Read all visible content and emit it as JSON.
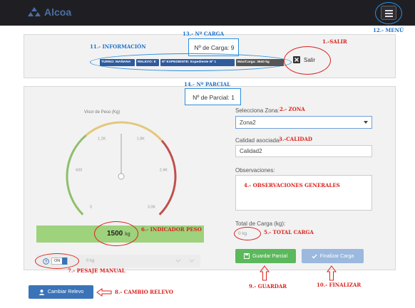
{
  "brand": {
    "name": "Alcoa",
    "color": "#4a6fa5"
  },
  "header": {
    "carga_label": "Nº de Carga: 9"
  },
  "badges": [
    {
      "text": "TURNO: MAÑANA",
      "color": "#2f5a9b"
    },
    {
      "text": "RELEVO: E",
      "color": "#2f5a9b"
    },
    {
      "text": "Nº EXPEDIENTE: Expediente Nº 1",
      "color": "#2f5a9b"
    },
    {
      "text": "Máx/Carga: 3640 kg",
      "color": "#555555"
    }
  ],
  "salir": {
    "label": "Salir",
    "icon": "close-icon"
  },
  "parcial": {
    "label": "Nº de Parcial: 1"
  },
  "gauge": {
    "title": "Visor de Peso (Kg)",
    "ticks": [
      "0",
      "600",
      "1.2K",
      "1.8K",
      "2.4K",
      "3.0K"
    ],
    "value_number": "1500",
    "value_unit": "kg",
    "value": 1500,
    "max": 3000,
    "colors": {
      "low": "#8fbf6d",
      "mid": "#e3c77a",
      "high": "#c0504d"
    },
    "bar_color": "#9ed27c"
  },
  "manual": {
    "toggle_label": "ON",
    "input_placeholder": "0 kg"
  },
  "form": {
    "zona_label": "Selecciona Zona:",
    "zona_value": "Zona2",
    "calidad_label": "Calidad asociada:",
    "calidad_value": "Calidad2",
    "obs_label": "Observaciones:",
    "total_label": "Total de Carga (kg):",
    "total_value": "0 kg"
  },
  "buttons": {
    "guardar": "Guardar Parcial",
    "finalizar": "Finalizar Carga",
    "cambiar_relevo": "Cambiar Relevo",
    "guardar_color": "#5cb85c",
    "finalizar_color": "#9bb8de",
    "relevo_color": "#3a73b8"
  },
  "annotations": {
    "a1": "1.-SALIR",
    "a2": "2.- ZONA",
    "a3": "3.-CALIDAD",
    "a4": "4.- OBSERVACIONES GENERALES",
    "a5": "5.- TOTAL CARGA",
    "a6": "6.- INDICADOR PESO",
    "a7": "7.- PESAJE MANUAL",
    "a8": "8.- CAMBIO RELEVO",
    "a9": "9.- GUARDAR",
    "a10": "10.- FINALIZAR",
    "a11": "11.- INFORMACIÓN",
    "a12": "12.- MENÚ",
    "a13": "13.- Nº CARGA",
    "a14": "14.- Nº PARCIAL"
  }
}
